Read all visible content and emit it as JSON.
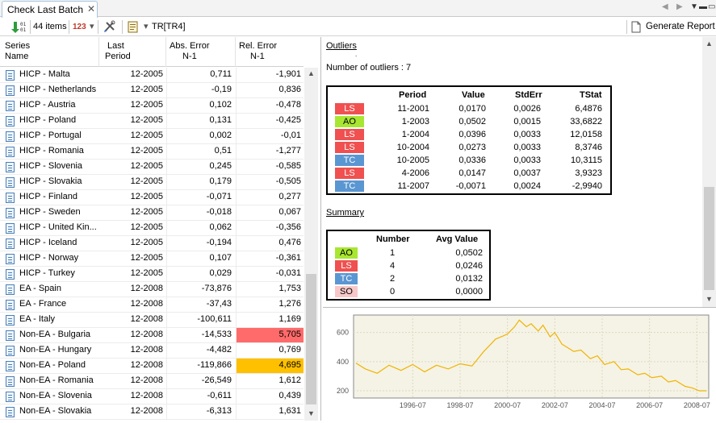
{
  "tab": {
    "label": "Check Last Batch",
    "close": "✕"
  },
  "window_controls": {
    "back": "◀",
    "forward": "▶",
    "menu": "▼",
    "minimize": "▬",
    "maximize": "▭"
  },
  "toolbar": {
    "download_icon": "download-icon",
    "items_count": "44 items",
    "numbers_icon": "123",
    "numbers_menu": "▾",
    "tools_icon": "tools-icon",
    "spec_icon": "spec-icon",
    "spec_menu": "▾",
    "spec_label": "TR[TR4]",
    "report_label": "Generate Report"
  },
  "grid": {
    "headers": {
      "series": [
        "Series",
        "Name"
      ],
      "period": [
        "Last",
        "Period"
      ],
      "abs": [
        "Abs. Error",
        "N-1"
      ],
      "rel": [
        "Rel. Error",
        "N-1"
      ]
    },
    "rows": [
      {
        "name": "HICP - Malta",
        "period": "12-2005",
        "abs": "0,711",
        "rel": "-1,901"
      },
      {
        "name": "HICP - Netherlands",
        "period": "12-2005",
        "abs": "-0,19",
        "rel": "0,836"
      },
      {
        "name": "HICP - Austria",
        "period": "12-2005",
        "abs": "0,102",
        "rel": "-0,478"
      },
      {
        "name": "HICP - Poland",
        "period": "12-2005",
        "abs": "0,131",
        "rel": "-0,425"
      },
      {
        "name": "HICP - Portugal",
        "period": "12-2005",
        "abs": "0,002",
        "rel": "-0,01"
      },
      {
        "name": "HICP - Romania",
        "period": "12-2005",
        "abs": "0,51",
        "rel": "-1,277"
      },
      {
        "name": "HICP - Slovenia",
        "period": "12-2005",
        "abs": "0,245",
        "rel": "-0,585"
      },
      {
        "name": "HICP - Slovakia",
        "period": "12-2005",
        "abs": "0,179",
        "rel": "-0,505"
      },
      {
        "name": "HICP - Finland",
        "period": "12-2005",
        "abs": "-0,071",
        "rel": "0,277"
      },
      {
        "name": "HICP - Sweden",
        "period": "12-2005",
        "abs": "-0,018",
        "rel": "0,067"
      },
      {
        "name": "HICP - United Kin...",
        "period": "12-2005",
        "abs": "0,062",
        "rel": "-0,356"
      },
      {
        "name": "HICP - Iceland",
        "period": "12-2005",
        "abs": "-0,194",
        "rel": "0,476"
      },
      {
        "name": "HICP - Norway",
        "period": "12-2005",
        "abs": "0,107",
        "rel": "-0,361"
      },
      {
        "name": "HICP - Turkey",
        "period": "12-2005",
        "abs": "0,029",
        "rel": "-0,031"
      },
      {
        "name": "EA - Spain",
        "period": "12-2008",
        "abs": "-73,876",
        "rel": "1,753"
      },
      {
        "name": "EA - France",
        "period": "12-2008",
        "abs": "-37,43",
        "rel": "1,276"
      },
      {
        "name": "EA - Italy",
        "period": "12-2008",
        "abs": "-100,611",
        "rel": "1,169"
      },
      {
        "name": "Non-EA - Bulgaria",
        "period": "12-2008",
        "abs": "-14,533",
        "rel": "5,705",
        "highlight": "#ff6b6b"
      },
      {
        "name": "Non-EA - Hungary",
        "period": "12-2008",
        "abs": "-4,482",
        "rel": "0,769"
      },
      {
        "name": "Non-EA - Poland",
        "period": "12-2008",
        "abs": "-119,866",
        "rel": "4,695",
        "highlight": "#ffc000"
      },
      {
        "name": "Non-EA - Romania",
        "period": "12-2008",
        "abs": "-26,549",
        "rel": "1,612"
      },
      {
        "name": "Non-EA - Slovenia",
        "period": "12-2008",
        "abs": "-0,611",
        "rel": "0,439"
      },
      {
        "name": "Non-EA - Slovakia",
        "period": "12-2008",
        "abs": "-6,313",
        "rel": "1,631"
      }
    ]
  },
  "scroll": {
    "up": "▲",
    "down": "▼"
  },
  "report": {
    "outliers_title": "Outliers",
    "dot": ".",
    "count_text": "Number of outliers : 7",
    "outlier_headers": [
      "Period",
      "Value",
      "StdErr",
      "TStat"
    ],
    "outliers": [
      {
        "type": "LS",
        "period": "11-2001",
        "value": "0,0170",
        "stderr": "0,0026",
        "tstat": "6,4876"
      },
      {
        "type": "AO",
        "period": "1-2003",
        "value": "0,0502",
        "stderr": "0,0015",
        "tstat": "33,6822"
      },
      {
        "type": "LS",
        "period": "1-2004",
        "value": "0,0396",
        "stderr": "0,0033",
        "tstat": "12,0158"
      },
      {
        "type": "LS",
        "period": "10-2004",
        "value": "0,0273",
        "stderr": "0,0033",
        "tstat": "8,3746"
      },
      {
        "type": "TC",
        "period": "10-2005",
        "value": "0,0336",
        "stderr": "0,0033",
        "tstat": "10,3115"
      },
      {
        "type": "LS",
        "period": "4-2006",
        "value": "0,0147",
        "stderr": "0,0037",
        "tstat": "3,9323"
      },
      {
        "type": "TC",
        "period": "11-2007",
        "value": "-0,0071",
        "stderr": "0,0024",
        "tstat": "-2,9940"
      }
    ],
    "summary_title": "Summary",
    "summary_headers": [
      "Number",
      "Avg Value"
    ],
    "summary": [
      {
        "type": "AO",
        "number": "1",
        "avg": "0,0502"
      },
      {
        "type": "LS",
        "number": "4",
        "avg": "0,0246"
      },
      {
        "type": "TC",
        "number": "2",
        "avg": "0,0132"
      },
      {
        "type": "SO",
        "number": "0",
        "avg": "0,0000"
      }
    ],
    "type_colors": {
      "LS": "#f05050",
      "AO": "#a8e632",
      "TC": "#5a96d2",
      "SO": "#f7c8c8"
    }
  },
  "chart_data": {
    "type": "line",
    "title": "",
    "xlabel": "",
    "ylabel": "",
    "xlim": [
      1994.0,
      2009.0
    ],
    "ylim": [
      150,
      720
    ],
    "yticks": [
      200,
      400,
      600
    ],
    "xticks": [
      "1996-07",
      "1998-07",
      "2000-07",
      "2002-07",
      "2004-07",
      "2006-07",
      "2008-07"
    ],
    "xtick_values": [
      1996.5,
      1998.5,
      2000.5,
      2002.5,
      2004.5,
      2006.5,
      2008.5
    ],
    "grid": true,
    "line_color": "#f0b400",
    "series": [
      {
        "x": [
          1994.1,
          1994.5,
          1995.0,
          1995.5,
          1996.0,
          1996.5,
          1997.0,
          1997.5,
          1998.0,
          1998.5,
          1999.0,
          1999.3,
          1999.5,
          1999.8,
          2000.0,
          2000.3,
          2000.5,
          2000.8,
          2001.0,
          2001.3,
          2001.5,
          2001.8,
          2002.0,
          2002.3,
          2002.5,
          2002.8,
          2003.0,
          2003.3,
          2003.6,
          2004.0,
          2004.3,
          2004.6,
          2005.0,
          2005.3,
          2005.6,
          2006.0,
          2006.3,
          2006.6,
          2007.0,
          2007.3,
          2007.6,
          2008.0,
          2008.3,
          2008.6,
          2008.9
        ],
        "values": [
          390,
          350,
          320,
          375,
          340,
          380,
          330,
          375,
          350,
          385,
          370,
          430,
          470,
          520,
          555,
          575,
          590,
          640,
          685,
          640,
          660,
          610,
          650,
          570,
          600,
          520,
          500,
          470,
          480,
          420,
          440,
          380,
          400,
          345,
          350,
          310,
          320,
          290,
          300,
          260,
          270,
          230,
          220,
          200,
          200
        ]
      }
    ]
  }
}
